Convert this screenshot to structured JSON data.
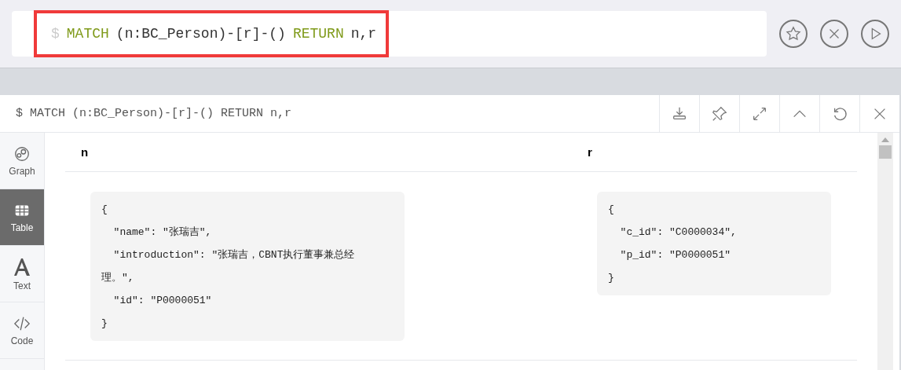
{
  "editor": {
    "query": [
      {
        "kind": "prompt",
        "text": "$"
      },
      {
        "kind": "keyword",
        "text": "MATCH"
      },
      {
        "kind": "plain",
        "text": "(n:BC_Person)-[r]-()"
      },
      {
        "kind": "keyword",
        "text": "RETURN"
      },
      {
        "kind": "plain",
        "text": "n,r"
      }
    ],
    "highlighted": true
  },
  "frame": {
    "title": "$ MATCH (n:BC_Person)-[r]-() RETURN n,r",
    "views": [
      {
        "label": "Graph",
        "selected": false
      },
      {
        "label": "Table",
        "selected": true
      },
      {
        "label": "Text",
        "selected": false
      },
      {
        "label": "Code",
        "selected": false
      }
    ],
    "table": {
      "columns": [
        "n",
        "r"
      ],
      "rows": [
        [
          [
            "{",
            "  \"name\": \"张瑞吉\",",
            "  \"introduction\": \"张瑞吉，CBNT执行董事兼总经",
            "理。\",",
            "  \"id\": \"P0000051\"",
            "}"
          ],
          [
            "{",
            "  \"c_id\": \"C0000034\",",
            "  \"p_id\": \"P0000051\"",
            "}"
          ]
        ]
      ]
    }
  }
}
